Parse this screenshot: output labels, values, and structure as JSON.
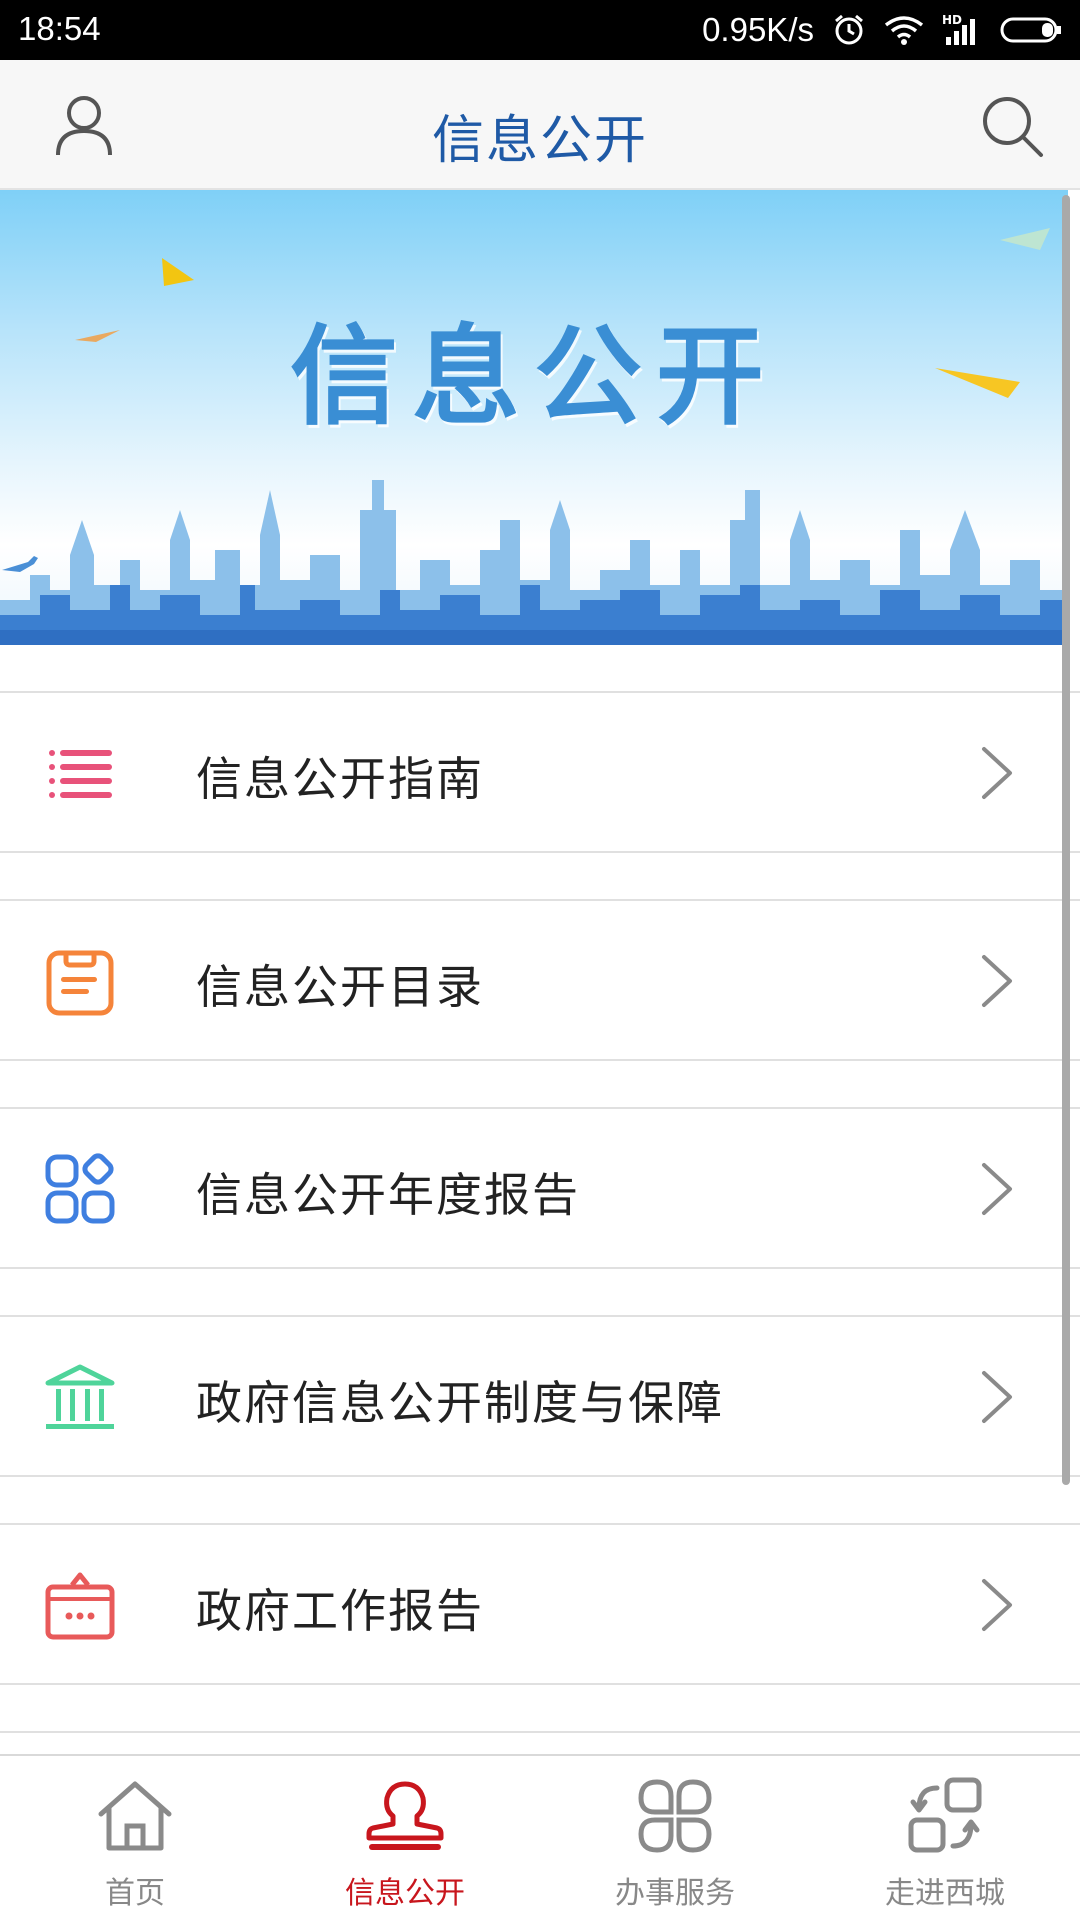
{
  "status_bar": {
    "time": "18:54",
    "speed": "0.95K/s",
    "hd_label": "HD",
    "icons": [
      "alarm-icon",
      "wifi-icon",
      "signal-icon",
      "battery-icon"
    ]
  },
  "header": {
    "title": "信息公开",
    "left_icon": "user-icon",
    "right_icon": "search-icon"
  },
  "banner": {
    "title": "信息公开"
  },
  "menu": {
    "items": [
      {
        "label": "信息公开指南",
        "icon": "list-icon",
        "color": "#e8527a"
      },
      {
        "label": "信息公开目录",
        "icon": "clipboard-icon",
        "color": "#f5843a"
      },
      {
        "label": "信息公开年度报告",
        "icon": "grid-icon",
        "color": "#3f7fe0"
      },
      {
        "label": "政府信息公开制度与保障",
        "icon": "institution-icon",
        "color": "#4fd49a"
      },
      {
        "label": "政府工作报告",
        "icon": "briefcase-icon",
        "color": "#e85a5a"
      }
    ]
  },
  "bottom_nav": {
    "items": [
      {
        "label": "首页",
        "icon": "home-icon",
        "active": false
      },
      {
        "label": "信息公开",
        "icon": "stamp-icon",
        "active": true
      },
      {
        "label": "办事服务",
        "icon": "apps-icon",
        "active": false
      },
      {
        "label": "走进西城",
        "icon": "exchange-icon",
        "active": false
      }
    ],
    "active_color": "#c8161d",
    "inactive_color": "#888888"
  }
}
